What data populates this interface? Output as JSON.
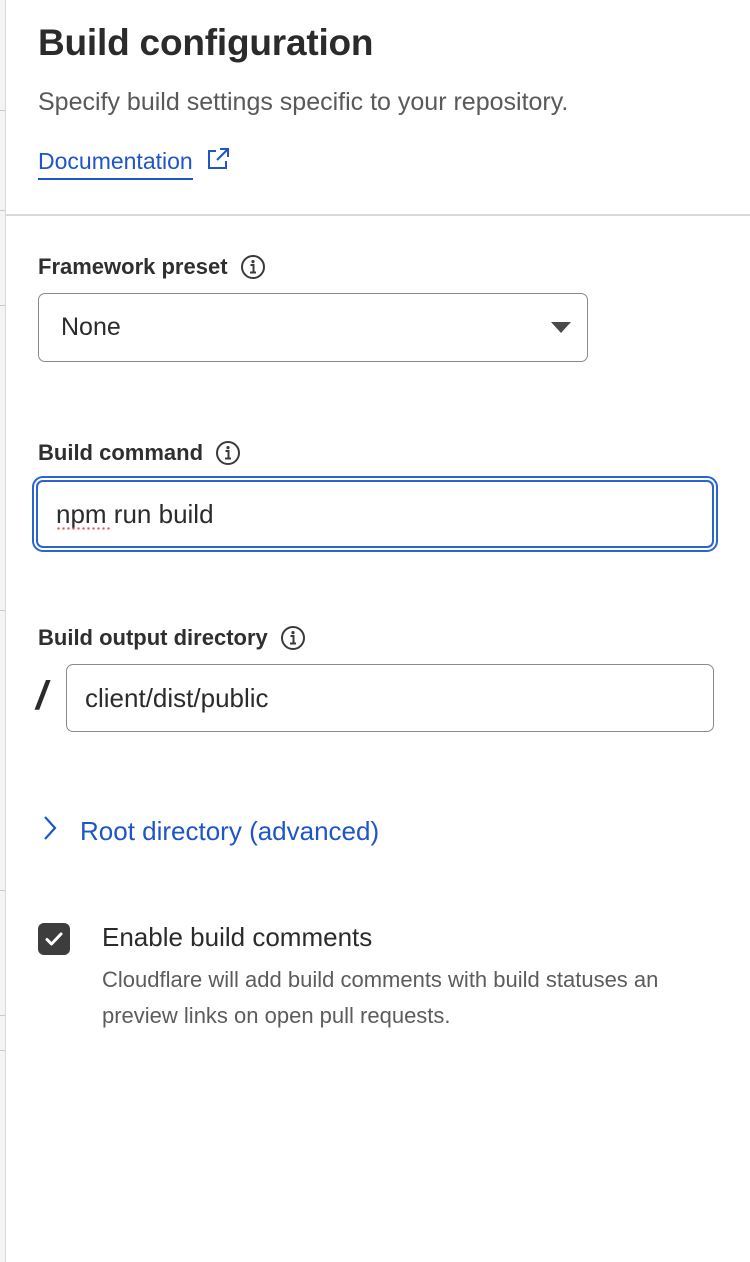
{
  "header": {
    "title": "Build configuration",
    "subtitle": "Specify build settings specific to your repository.",
    "doc_link_label": "Documentation",
    "doc_link_icon": "external-link-icon"
  },
  "framework_preset": {
    "label": "Framework preset",
    "selected_value": "None",
    "info_icon": "info-icon"
  },
  "build_command": {
    "label": "Build command",
    "value": "npm run build",
    "info_icon": "info-icon"
  },
  "build_output_directory": {
    "label": "Build output directory",
    "prefix": "/",
    "value": "client/dist/public",
    "info_icon": "info-icon"
  },
  "root_directory": {
    "label": "Root directory (advanced)",
    "icon": "chevron-right-icon"
  },
  "build_comments": {
    "label": "Enable build comments",
    "description_line1": "Cloudflare will add build comments with build statuses an",
    "description_line2": "preview links on open pull requests.",
    "checked": true
  },
  "colors": {
    "link": "#1e55c8",
    "focus": "#2a63d4",
    "checkbox": "#3d3d3d"
  }
}
